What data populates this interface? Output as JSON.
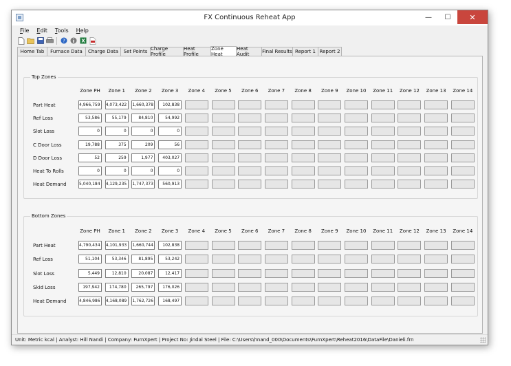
{
  "window": {
    "title": "FX Continuous Reheat App"
  },
  "window_controls": {
    "minimize": "—",
    "maximize": "☐",
    "close": "✕"
  },
  "menu": [
    {
      "u": "F",
      "rest": "ile"
    },
    {
      "u": "E",
      "rest": "dit"
    },
    {
      "u": "T",
      "rest": "ools"
    },
    {
      "u": "H",
      "rest": "elp"
    }
  ],
  "toolbar_icons": [
    "new-file-icon",
    "open-folder-icon",
    "save-icon",
    "print-icon",
    "help-icon",
    "info-icon",
    "excel-icon",
    "pdf-icon"
  ],
  "tabs": [
    "Home Tab",
    "Furnace Data",
    "Charge Data",
    "Set Points",
    "Charge Profile",
    "Heat Profile",
    "Zone Heat",
    "Heat Audit",
    "Final Results",
    "Report 1",
    "Report 2"
  ],
  "active_tab": "Zone Heat",
  "zones": [
    "Zone PH",
    "Zone 1",
    "Zone 2",
    "Zone 3",
    "Zone 4",
    "Zone 5",
    "Zone 6",
    "Zone 7",
    "Zone 8",
    "Zone 9",
    "Zone 10",
    "Zone 11",
    "Zone 12",
    "Zone 13",
    "Zone 14"
  ],
  "top_zones": {
    "title": "Top Zones",
    "rows": [
      {
        "label": "Part Heat",
        "values": [
          "4,966,759",
          "4,073,422",
          "1,660,378",
          "102,838"
        ]
      },
      {
        "label": "Ref Loss",
        "values": [
          "53,586",
          "55,179",
          "84,810",
          "54,992"
        ]
      },
      {
        "label": "Slot Loss",
        "values": [
          "0",
          "0",
          "0",
          "0"
        ]
      },
      {
        "label": "C Door Loss",
        "values": [
          "19,788",
          "375",
          "209",
          "56"
        ]
      },
      {
        "label": "D Door Loss",
        "values": [
          "52",
          "259",
          "1,977",
          "403,027"
        ]
      },
      {
        "label": "Heat To Rolls",
        "values": [
          "0",
          "0",
          "0",
          "0"
        ]
      },
      {
        "label": "Heat Demand",
        "values": [
          "5,040,184",
          "4,129,235",
          "1,747,373",
          "560,913"
        ]
      }
    ]
  },
  "bottom_zones": {
    "title": "Bottom Zones",
    "rows": [
      {
        "label": "Part Heat",
        "values": [
          "4,790,434",
          "4,101,933",
          "1,660,744",
          "102,838"
        ]
      },
      {
        "label": "Ref Loss",
        "values": [
          "51,104",
          "53,346",
          "81,895",
          "53,242"
        ]
      },
      {
        "label": "Slot Loss",
        "values": [
          "5,449",
          "12,810",
          "20,087",
          "12,417"
        ]
      },
      {
        "label": "Skid Loss",
        "values": [
          "197,942",
          "174,780",
          "265,797",
          "176,026"
        ]
      },
      {
        "label": "Heat Demand",
        "values": [
          "4,846,986",
          "4,168,089",
          "1,762,726",
          "168,497"
        ]
      }
    ]
  },
  "status": "Unit:  Metric kcal  | Analyst: Hill Nandi  | Company: FurnXpert  | Project No: Jindal Steel  | File: C:\\Users\\hnand_000\\Documents\\FurnXpert\\Reheat2016\\DataFile\\Danieli.frn"
}
